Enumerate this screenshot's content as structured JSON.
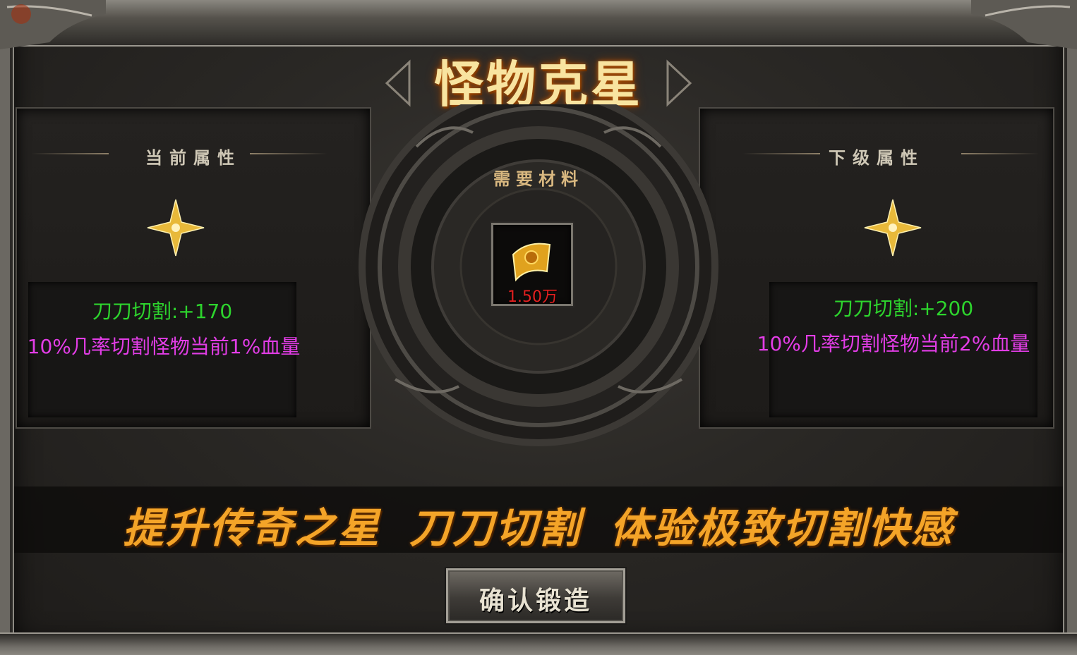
{
  "title": "怪物克星",
  "current_panel": {
    "heading": "当前属性",
    "stat_name_value": "刀刀切割:+170",
    "stat_effect": "10%几率切割怪物当前1%血量"
  },
  "next_panel": {
    "heading": "下级属性",
    "stat_name_value": "刀刀切割:+200",
    "stat_effect": "10%几率切割怪物当前2%血量"
  },
  "materials": {
    "heading": "需要材料",
    "item_icon": "gold-scroll-icon",
    "quantity": "1.50万"
  },
  "slogan": {
    "part1": "提升传奇之星",
    "part2": "刀刀切割",
    "part3": "体验极致切割快感"
  },
  "confirm_label": "确认锻造",
  "colors": {
    "stat_green": "#2dd42d",
    "stat_pink": "#e23de6",
    "slogan_orange": "#f4a428",
    "title_gold": "#f8e4a0",
    "quantity_red": "#e42020"
  }
}
